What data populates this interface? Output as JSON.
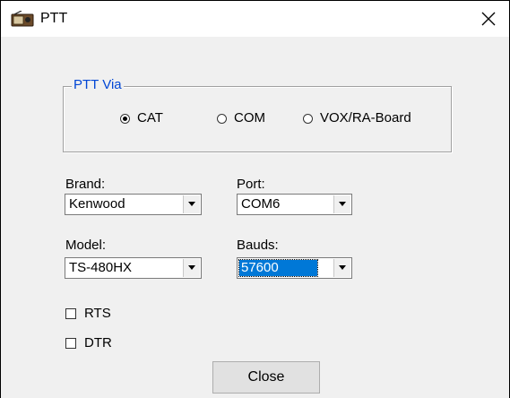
{
  "window": {
    "title": "PTT",
    "icon": "radio-icon",
    "close_icon": "close-icon"
  },
  "ptt_via": {
    "legend": "PTT Via",
    "options": [
      {
        "label": "CAT",
        "checked": true
      },
      {
        "label": "COM",
        "checked": false
      },
      {
        "label": "VOX/RA-Board",
        "checked": false
      }
    ]
  },
  "brand": {
    "label": "Brand:",
    "value": "Kenwood"
  },
  "port": {
    "label": "Port:",
    "value": "COM6"
  },
  "model": {
    "label": "Model:",
    "value": "TS-480HX"
  },
  "bauds": {
    "label": "Bauds:",
    "value": "57600"
  },
  "checkboxes": [
    {
      "label": "RTS",
      "checked": false
    },
    {
      "label": "DTR",
      "checked": false
    }
  ],
  "close_button": {
    "label": "Close"
  },
  "colors": {
    "legend_text": "#0046d5",
    "selection_bg": "#0078d7",
    "dialog_bg": "#f0f0f0"
  }
}
